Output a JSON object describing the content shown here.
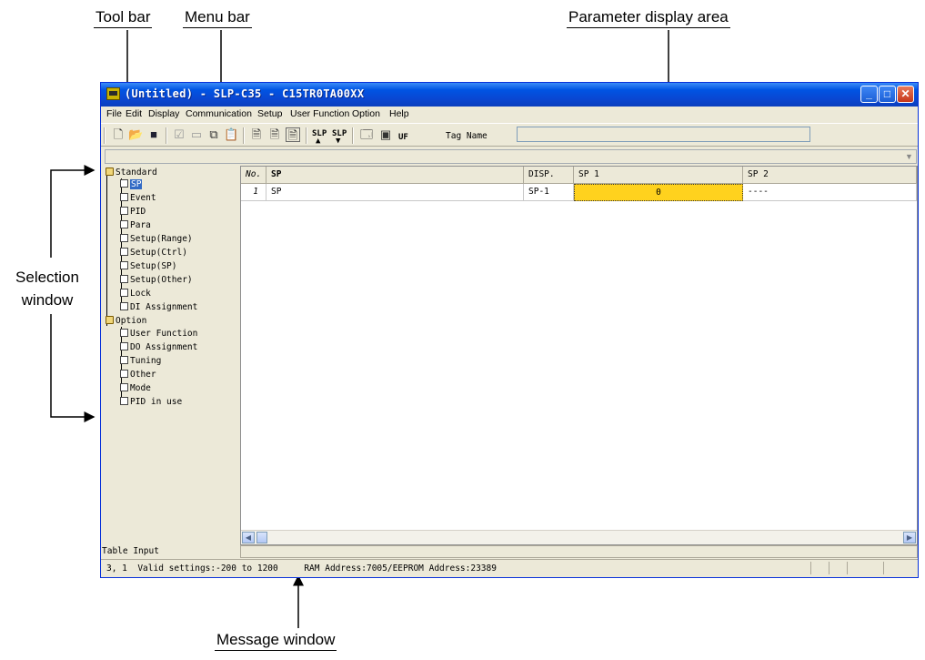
{
  "callouts": {
    "tool_bar": "Tool bar",
    "menu_bar": "Menu bar",
    "parameter_display_area": "Parameter display area",
    "selection_window_line1": "Selection",
    "selection_window_line2": "window",
    "message_window": "Message window"
  },
  "window": {
    "title": "(Untitled) - SLP-C35 - C15TR0TA00XX",
    "caption_buttons": [
      "minimize-icon",
      "maximize-icon",
      "close-icon"
    ]
  },
  "menu": {
    "items": [
      "File",
      "Edit",
      "Display",
      "Communication",
      "Setup",
      "User Function",
      "Option",
      "Help"
    ]
  },
  "toolbar": {
    "icons": [
      "new-icon",
      "open-icon",
      "save-icon",
      "check-icon",
      "disabled-icon",
      "copy-icon",
      "paste-icon",
      "page1-icon",
      "page2-icon",
      "page3-icon",
      "slp-upload-icon",
      "slp-download-icon",
      "properties-icon",
      "image-icon",
      "uf-icon"
    ],
    "slp_label": "SLP",
    "uf_label": "UF",
    "tag_name_label": "Tag Name",
    "tag_name_value": ""
  },
  "tree": {
    "standard": "Standard",
    "standard_items": [
      "SP",
      "Event",
      "PID",
      "Para",
      "Setup(Range)",
      "Setup(Ctrl)",
      "Setup(SP)",
      "Setup(Other)",
      "Lock",
      "DI Assignment"
    ],
    "selected": "SP",
    "option": "Option",
    "option_items": [
      "User Function",
      "DO Assignment",
      "Tuning",
      "Other",
      "Mode",
      "PID in use"
    ]
  },
  "grid": {
    "headers": [
      "No.",
      "SP",
      "DISP.",
      "SP 1",
      "SP 2"
    ],
    "rows": [
      {
        "no": "1",
        "name": "SP",
        "disp": "SP-1",
        "sp1": "0",
        "sp2": "----"
      }
    ],
    "highlight_color": "#ffd21e"
  },
  "bottom": {
    "mode_label": "Table Input",
    "status_text": "3, 1  Valid settings:-200 to 1200     RAM Address:7005/EEPROM Address:23389"
  },
  "colors": {
    "titlebar": "#0054e3",
    "window_bg": "#ece9d8",
    "selection": "#316ac5"
  }
}
